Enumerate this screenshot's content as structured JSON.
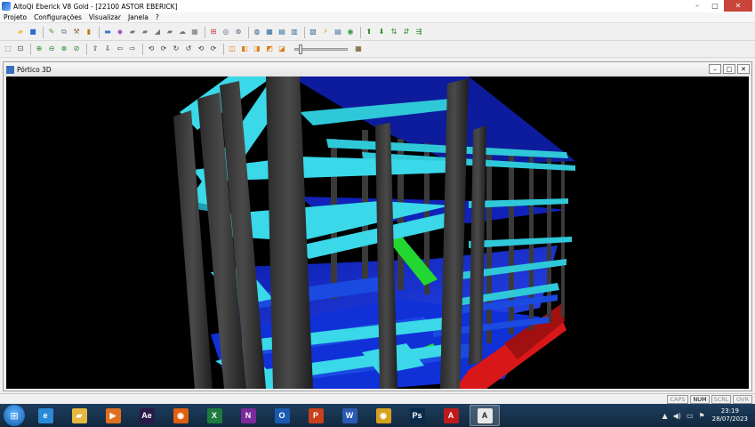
{
  "window": {
    "title": "AltoQi Eberick V8 Gold - [22100 ASTOR EBERICK]",
    "controls": {
      "minimize": "–",
      "maximize": "□",
      "close": "✕"
    }
  },
  "menu": [
    "Projeto",
    "Configurações",
    "Visualizar",
    "Janela",
    "?"
  ],
  "toolbar1": [
    {
      "icon": "new-file-icon",
      "glyph": "▯",
      "color": "#ffffff"
    },
    {
      "icon": "open-folder-icon",
      "glyph": "▰",
      "color": "#e8c043"
    },
    {
      "icon": "save-icon",
      "glyph": "■",
      "color": "#2e6fd0"
    },
    {
      "icon": "edit-icon",
      "glyph": "✎",
      "color": "#5a8f2a"
    },
    {
      "icon": "copy-icon",
      "glyph": "⧉",
      "color": "#6a7f9a"
    },
    {
      "icon": "tools-icon",
      "glyph": "⚒",
      "color": "#8a6a3a"
    },
    {
      "icon": "pillar-icon",
      "glyph": "▮",
      "color": "#c07a10"
    },
    {
      "icon": "beam-icon",
      "glyph": "▬",
      "color": "#2a7ad0"
    },
    {
      "icon": "slab-icon",
      "glyph": "◆",
      "color": "#9a5bc0"
    },
    {
      "icon": "wall-icon",
      "glyph": "▰",
      "color": "#777777"
    },
    {
      "icon": "foundation-icon",
      "glyph": "▰",
      "color": "#777777"
    },
    {
      "icon": "stair-icon",
      "glyph": "◢",
      "color": "#777777"
    },
    {
      "icon": "load-icon",
      "glyph": "▰",
      "color": "#777777"
    },
    {
      "icon": "cloud-icon",
      "glyph": "☁",
      "color": "#777777"
    },
    {
      "icon": "grid-icon",
      "glyph": "▦",
      "color": "#777777"
    },
    {
      "icon": "frame-icon",
      "glyph": "⊞",
      "color": "#c03a3a"
    },
    {
      "icon": "analysis-icon",
      "glyph": "◎",
      "color": "#5a6a80"
    },
    {
      "icon": "calc-icon",
      "glyph": "⊗",
      "color": "#5a6a80"
    },
    {
      "icon": "globe-icon",
      "glyph": "◍",
      "color": "#2a5aa0"
    },
    {
      "icon": "table-icon",
      "glyph": "▦",
      "color": "#2a6a9a"
    },
    {
      "icon": "report-icon",
      "glyph": "▤",
      "color": "#2a6a9a"
    },
    {
      "icon": "detail-icon",
      "glyph": "▥",
      "color": "#2a6a9a"
    },
    {
      "icon": "drawing-icon",
      "glyph": "▧",
      "color": "#2a6a9a"
    },
    {
      "icon": "lightning-icon",
      "glyph": "⚡",
      "color": "#e0a000"
    },
    {
      "icon": "print-icon",
      "glyph": "▤",
      "color": "#3a6aa0"
    },
    {
      "icon": "help-icon",
      "glyph": "◉",
      "color": "#2e9a3a"
    },
    {
      "icon": "floor-up-icon",
      "glyph": "⬆",
      "color": "#2a8a2a"
    },
    {
      "icon": "floor-down-icon",
      "glyph": "⬇",
      "color": "#2a8a2a"
    },
    {
      "icon": "floor-copy-icon",
      "glyph": "⇅",
      "color": "#2a8a2a"
    },
    {
      "icon": "floor-view-icon",
      "glyph": "⇵",
      "color": "#2a8a2a"
    },
    {
      "icon": "floor-list-icon",
      "glyph": "⇶",
      "color": "#2a8a2a"
    }
  ],
  "toolbar2": [
    {
      "icon": "select-icon",
      "glyph": "⬚",
      "color": "#444444"
    },
    {
      "icon": "zoom-window-icon",
      "glyph": "⊡",
      "color": "#444444"
    },
    {
      "icon": "zoom-in-icon",
      "glyph": "⊕",
      "color": "#2a8a2a"
    },
    {
      "icon": "zoom-out-icon",
      "glyph": "⊖",
      "color": "#2a8a2a"
    },
    {
      "icon": "zoom-all-icon",
      "glyph": "⊗",
      "color": "#2a8a2a"
    },
    {
      "icon": "zoom-previous-icon",
      "glyph": "⊘",
      "color": "#2a8a2a"
    },
    {
      "icon": "pan-up-icon",
      "glyph": "⇧",
      "color": "#333333"
    },
    {
      "icon": "pan-down-icon",
      "glyph": "⇩",
      "color": "#333333"
    },
    {
      "icon": "pan-left-icon",
      "glyph": "⇦",
      "color": "#333333"
    },
    {
      "icon": "pan-right-icon",
      "glyph": "⇨",
      "color": "#333333"
    },
    {
      "icon": "rotate-icon",
      "glyph": "⟲",
      "color": "#333333"
    },
    {
      "icon": "rotate-x-icon",
      "glyph": "⟳",
      "color": "#333333"
    },
    {
      "icon": "rotate-y-icon",
      "glyph": "↻",
      "color": "#333333"
    },
    {
      "icon": "rotate-z-icon",
      "glyph": "↺",
      "color": "#333333"
    },
    {
      "icon": "orbit-icon",
      "glyph": "⟲",
      "color": "#333333"
    },
    {
      "icon": "reset-view-icon",
      "glyph": "⟳",
      "color": "#333333"
    },
    {
      "icon": "view-solid-icon",
      "glyph": "◫",
      "color": "#e07a10"
    },
    {
      "icon": "view-front-icon",
      "glyph": "◧",
      "color": "#e07a10"
    },
    {
      "icon": "view-side-icon",
      "glyph": "◨",
      "color": "#e07a10"
    },
    {
      "icon": "view-top-icon",
      "glyph": "◩",
      "color": "#e07a10"
    },
    {
      "icon": "view-iso-icon",
      "glyph": "◪",
      "color": "#e07a10"
    }
  ],
  "toolbar2_end_icon": {
    "icon": "grid-toggle-icon",
    "glyph": "▦",
    "color": "#6a4a1a"
  },
  "child_window": {
    "title": "Pórtico 3D",
    "controls": {
      "minimize": "–",
      "restore": "□",
      "close": "✕"
    }
  },
  "status": {
    "indicators": [
      "CAPS",
      "NUM",
      "SCRL",
      "OVR"
    ],
    "active": [
      "NUM"
    ]
  },
  "taskbar": {
    "apps": [
      {
        "name": "internet-explorer",
        "icon": "ie-icon",
        "glyph": "e",
        "color": "#2a8ad8"
      },
      {
        "name": "file-explorer",
        "icon": "folder-icon",
        "glyph": "▰",
        "color": "#e6b840"
      },
      {
        "name": "media-player",
        "icon": "play-icon",
        "glyph": "▶",
        "color": "#e07020"
      },
      {
        "name": "after-effects",
        "icon": "ae-icon",
        "glyph": "Ae",
        "color": "#2a1a4a"
      },
      {
        "name": "firefox",
        "icon": "firefox-icon",
        "glyph": "◉",
        "color": "#e06010"
      },
      {
        "name": "excel",
        "icon": "excel-icon",
        "glyph": "X",
        "color": "#1e7a3e"
      },
      {
        "name": "onenote",
        "icon": "onenote-icon",
        "glyph": "N",
        "color": "#7a2a9a"
      },
      {
        "name": "outlook",
        "icon": "outlook-icon",
        "glyph": "O",
        "color": "#1a5ab0"
      },
      {
        "name": "powerpoint",
        "icon": "powerpoint-icon",
        "glyph": "P",
        "color": "#c8401a"
      },
      {
        "name": "word",
        "icon": "word-icon",
        "glyph": "W",
        "color": "#2a5ab0"
      },
      {
        "name": "chrome",
        "icon": "chrome-icon",
        "glyph": "◉",
        "color": "#d8a020"
      },
      {
        "name": "photoshop",
        "icon": "photoshop-icon",
        "glyph": "Ps",
        "color": "#0a2a4a"
      },
      {
        "name": "autocad",
        "icon": "autocad-icon",
        "glyph": "A",
        "color": "#c01a1a"
      },
      {
        "name": "eberick",
        "icon": "eberick-icon",
        "glyph": "A",
        "color": "#e8e8e8",
        "active": true
      }
    ],
    "clock_time": "23:19",
    "clock_date": "28/07/2023"
  }
}
